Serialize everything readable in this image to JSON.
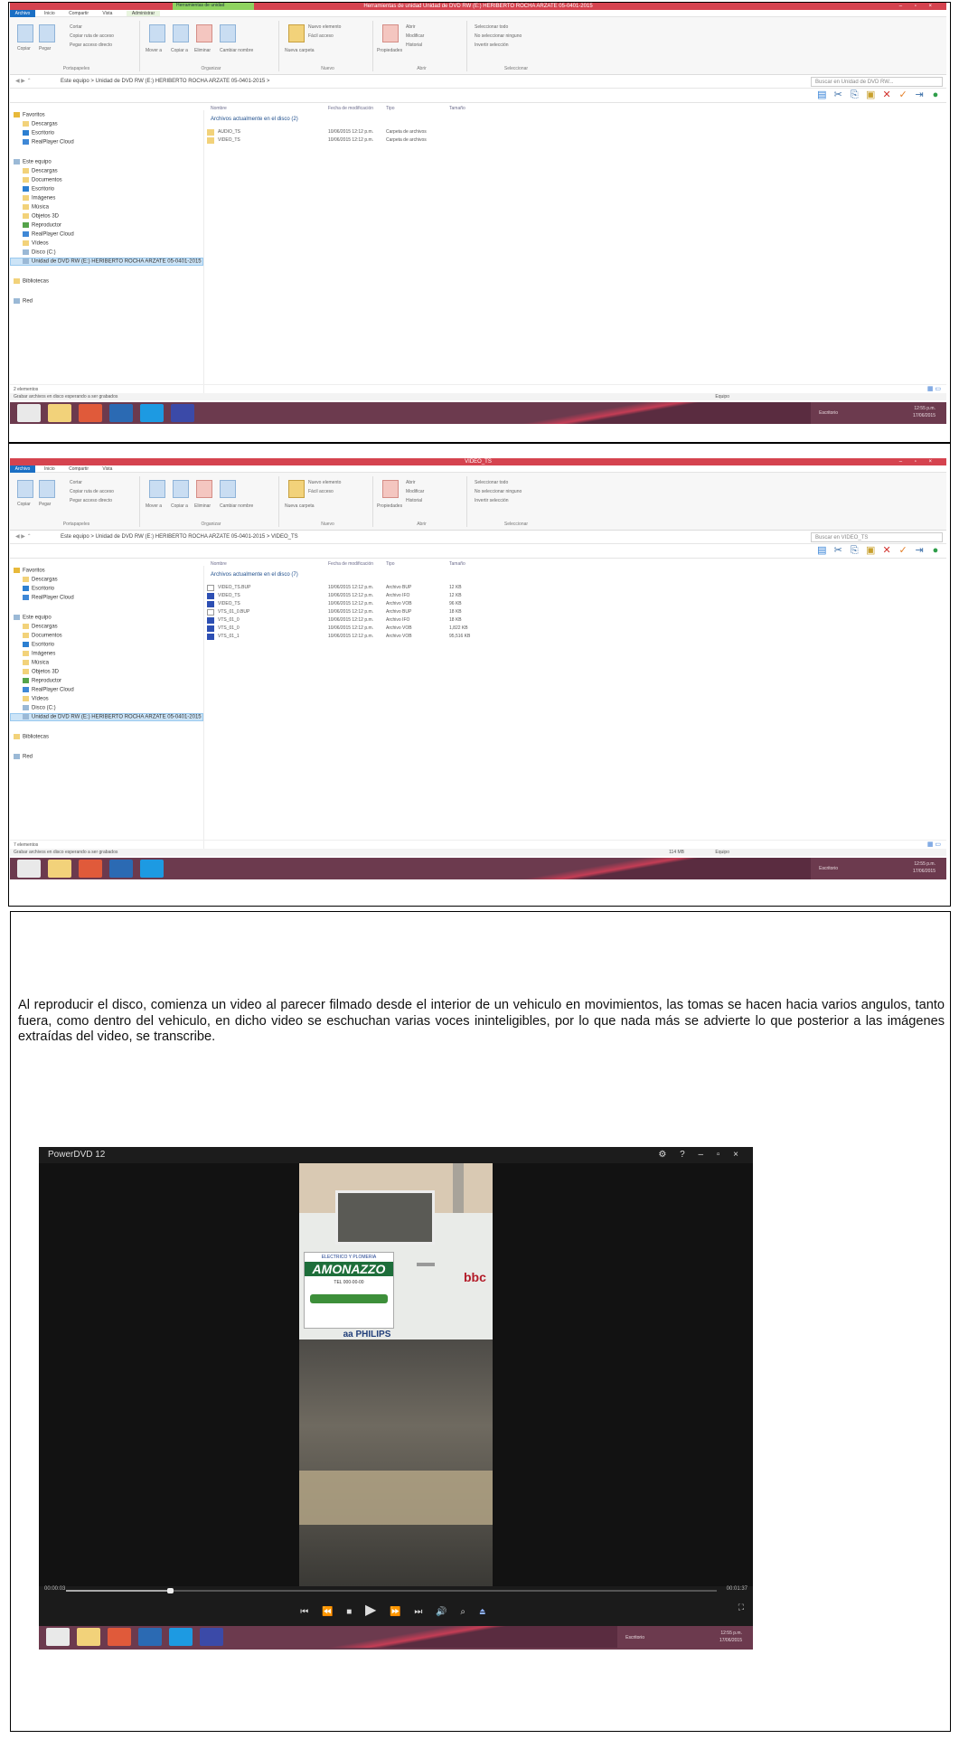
{
  "screen1": {
    "window_title": "Herramientas de unidad    Unidad de DVD RW (E:) HERIBERTO ROCHA ARZATE 05-0401-2015",
    "highlight_tab": "Herramientas de unidad",
    "menu": [
      "Archivo",
      "Inicio",
      "Compartir",
      "Vista",
      "Administrar"
    ],
    "address_path": "Este equipo > Unidad de DVD RW (E:) HERIBERTO ROCHA ARZATE 05-0401-2015 >",
    "search_placeholder": "Buscar en Unidad de DVD RW...",
    "columns": [
      "Nombre",
      "Fecha de modificación",
      "Tipo",
      "Tamaño"
    ],
    "group_header": "Archivos actualmente en el disco (2)",
    "files": [
      {
        "name": "AUDIO_TS",
        "date": "10/06/2015 12:12 p.m.",
        "type": "Carpeta de archivos",
        "size": ""
      },
      {
        "name": "VIDEO_TS",
        "date": "10/06/2015 12:12 p.m.",
        "type": "Carpeta de archivos",
        "size": ""
      }
    ],
    "status_items": "2 elementos",
    "status_bottom": "Grabar archivos en disco esperando a ser grabados",
    "status_right": "Equipo",
    "tray_text": "Escritorio",
    "clock_time": "12:55 p.m.",
    "clock_date": "17/06/2015"
  },
  "screen2": {
    "window_title": "VIDEO_TS",
    "highlight_tab": "",
    "menu": [
      "Archivo",
      "Inicio",
      "Compartir",
      "Vista"
    ],
    "address_path": "Este equipo > Unidad de DVD RW (E:) HERIBERTO ROCHA ARZATE 05-0401-2015 > VIDEO_TS",
    "search_placeholder": "Buscar en VIDEO_TS",
    "columns": [
      "Nombre",
      "Fecha de modificación",
      "Tipo",
      "Tamaño"
    ],
    "group_header": "Archivos actualmente en el disco (7)",
    "files": [
      {
        "name": "VIDEO_TS.BUP",
        "date": "10/06/2015 12:12 p.m.",
        "type": "Archivo BUP",
        "size": "12 KB"
      },
      {
        "name": "VIDEO_TS",
        "date": "10/06/2015 12:12 p.m.",
        "type": "Archivo IFO",
        "size": "12 KB"
      },
      {
        "name": "VIDEO_TS",
        "date": "10/06/2015 12:12 p.m.",
        "type": "Archivo VOB",
        "size": "96 KB"
      },
      {
        "name": "VTS_01_0.BUP",
        "date": "10/06/2015 12:12 p.m.",
        "type": "Archivo BUP",
        "size": "18 KB"
      },
      {
        "name": "VTS_01_0",
        "date": "10/06/2015 12:12 p.m.",
        "type": "Archivo IFO",
        "size": "18 KB"
      },
      {
        "name": "VTS_01_0",
        "date": "10/06/2015 12:12 p.m.",
        "type": "Archivo VOB",
        "size": "1,822 KB"
      },
      {
        "name": "VTS_01_1",
        "date": "10/06/2015 12:12 p.m.",
        "type": "Archivo VOB",
        "size": "95,516 KB"
      }
    ],
    "status_items": "7 elementos",
    "status_bottom": "Grabar archivos en disco esperando a ser grabados",
    "status_mid": "114 MB",
    "status_right": "Equipo",
    "tray_text": "Escritorio",
    "clock_time": "12:55 p.m.",
    "clock_date": "17/06/2015"
  },
  "ribbon": {
    "groups": [
      "Portapapeles",
      "Organizar",
      "Nuevo",
      "Abrir",
      "Seleccionar"
    ],
    "copy": "Copiar",
    "paste": "Pegar",
    "cut": "Cortar",
    "copy_path": "Copiar ruta de acceso",
    "paste_shortcut": "Pegar acceso directo",
    "move_to": "Mover a",
    "copy_to": "Copiar a",
    "delete": "Eliminar",
    "rename": "Cambiar nombre",
    "new_folder": "Nueva carpeta",
    "new_item": "Nuevo elemento",
    "easy_access": "Fácil acceso",
    "properties": "Propiedades",
    "open": "Abrir",
    "edit": "Modificar",
    "history": "Historial",
    "select_all": "Seleccionar todo",
    "select_none": "No seleccionar ninguno",
    "invert": "Invertir selección"
  },
  "nav": {
    "favorites": "Favoritos",
    "fav_items": [
      "Descargas",
      "Escritorio",
      "RealPlayer Cloud"
    ],
    "this_pc": "Este equipo",
    "pc_items": [
      "Descargas",
      "Documentos",
      "Escritorio",
      "Imágenes",
      "Música",
      "Objetos 3D",
      "Reproductor",
      "RealPlayer Cloud",
      "Vídeos",
      "Disco (C:)"
    ],
    "dvd_drive": "Unidad de DVD RW (E:) HERIBERTO ROCHA ARZATE 05-0401-2015",
    "libraries": "Bibliotecas",
    "network": "Red"
  },
  "paragraph": "Al reproducir el disco, comienza un video al parecer filmado desde el interior de un vehiculo en movimientos, las tomas se hacen hacia varios angulos, tanto fuera, como dentro del vehiculo, en dicho video se eschuchan varias voces ininteligibles, por lo que nada más se advierte lo que posterior a las imágenes extraídas del video, se transcribe.",
  "player": {
    "app_name": "PowerDVD 12",
    "time_left": "00:00:03",
    "time_right": "00:01:37",
    "progress": 0.16,
    "truck_sign_top": "ELECTRICO Y PLOMERIA",
    "truck_sign_name": "AMONAZZO",
    "truck_sign_phone": "TEL 000-00-00",
    "truck_brands": "aa  PHILIPS",
    "truck_side": "bbc",
    "taskbar_text": "Escritorio",
    "clock_time": "12:55 p.m.",
    "clock_date": "17/06/2015"
  },
  "colors": {
    "titlebar": "#d5434f",
    "taskbar": "#6c3a4e",
    "accent_blue": "#1b6fc4",
    "highlight_green": "#8fd35f"
  }
}
